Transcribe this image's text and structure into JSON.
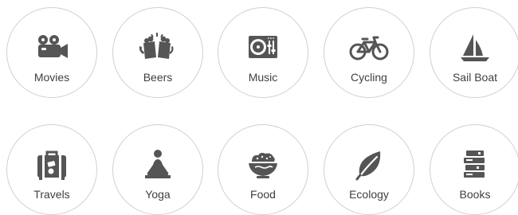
{
  "interests": [
    {
      "label": "Movies",
      "icon": "movie-camera-icon"
    },
    {
      "label": "Beers",
      "icon": "beer-mugs-icon"
    },
    {
      "label": "Music",
      "icon": "turntable-mixer-icon"
    },
    {
      "label": "Cycling",
      "icon": "bicycle-icon"
    },
    {
      "label": "Sail Boat",
      "icon": "sailboat-icon"
    },
    {
      "label": "Travels",
      "icon": "suitcase-icon"
    },
    {
      "label": "Yoga",
      "icon": "yoga-pose-icon"
    },
    {
      "label": "Food",
      "icon": "food-bowl-icon"
    },
    {
      "label": "Ecology",
      "icon": "leaf-icon"
    },
    {
      "label": "Books",
      "icon": "book-stack-icon"
    }
  ],
  "colors": {
    "icon": "#555555",
    "label": "#3f3f3f",
    "border": "#d0d0d0",
    "background": "#ffffff"
  }
}
